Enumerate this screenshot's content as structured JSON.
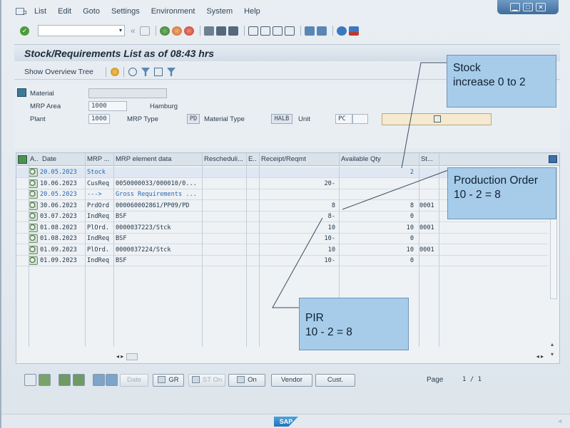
{
  "menu": [
    "List",
    "Edit",
    "Goto",
    "Settings",
    "Environment",
    "System",
    "Help"
  ],
  "window_buttons": [
    "minimize-icon",
    "maximize-icon",
    "close-icon"
  ],
  "window_button_glyphs": [
    "▁",
    "□",
    "✕"
  ],
  "toolbar": {
    "command_value": "",
    "dropdown_glyph": "▾",
    "back_glyph": "«"
  },
  "title": "Stock/Requirements List as of 08:43 hrs",
  "subtoolbar": {
    "show_overview_tree": "Show Overview Tree"
  },
  "header": {
    "material_label": "Material",
    "material_value": "",
    "material_desc": "",
    "mrp_area_label": "MRP Area",
    "mrp_area_value": "1000",
    "mrp_area_name": "Hamburg",
    "plant_label": "Plant",
    "plant_value": "1000",
    "mrp_type_label": "MRP Type",
    "mrp_type_value": "PD",
    "material_type_label": "Material Type",
    "material_type_value": "HALB",
    "unit_label": "Unit",
    "unit_value": "PC"
  },
  "grid": {
    "columns": [
      "A..",
      "Date",
      "MRP ...",
      "MRP element data",
      "Rescheduli...",
      "E..",
      "Receipt/Reqmt",
      "Available Qty",
      "St..."
    ],
    "rows": [
      {
        "date": "20.05.2023",
        "mrp": "Stock",
        "data": "",
        "qty": "",
        "avail": "2",
        "st": "",
        "blue": true,
        "selected": true
      },
      {
        "date": "10.06.2023",
        "mrp": "CusReq",
        "data": "0050000033/000010/0...",
        "qty": "20-",
        "avail": "",
        "st": "",
        "blue": false,
        "selected": false
      },
      {
        "date": "20.05.2023",
        "mrp": "--->",
        "data": "Gross Requirements ...",
        "qty": "",
        "avail": "",
        "st": "",
        "blue": true,
        "selected": false
      },
      {
        "date": "30.06.2023",
        "mrp": "PrdOrd",
        "data": "000060002861/PP09/PD",
        "qty": "8",
        "avail": "8",
        "st": "0001",
        "blue": false,
        "selected": false
      },
      {
        "date": "03.07.2023",
        "mrp": "IndReq",
        "data": "BSF",
        "qty": "8-",
        "avail": "0",
        "st": "",
        "blue": false,
        "selected": false
      },
      {
        "date": "01.08.2023",
        "mrp": "PlOrd.",
        "data": "0000037223/Stck",
        "qty": "10",
        "avail": "10",
        "st": "0001",
        "blue": false,
        "selected": false
      },
      {
        "date": "01.08.2023",
        "mrp": "IndReq",
        "data": "BSF",
        "qty": "10-",
        "avail": "0",
        "st": "",
        "blue": false,
        "selected": false
      },
      {
        "date": "01.09.2023",
        "mrp": "PlOrd.",
        "data": "0000037224/Stck",
        "qty": "10",
        "avail": "10",
        "st": "0001",
        "blue": false,
        "selected": false
      },
      {
        "date": "01.09.2023",
        "mrp": "IndReq",
        "data": "BSF",
        "qty": "10-",
        "avail": "0",
        "st": "",
        "blue": false,
        "selected": false
      }
    ],
    "pager_left": "◂ ▸",
    "pager_right": "◂ ▸"
  },
  "bottom": {
    "date_btn": "Date",
    "gr_btn": "GR",
    "st_on_btn": "ST On",
    "on_btn": "On",
    "vendor_btn": "Vendor",
    "cust_btn": "Cust.",
    "page_label": "Page",
    "page_value": "1  /  1"
  },
  "footer": {
    "logo": "SAP",
    "arrow": "◃"
  },
  "annotations": {
    "stock": "Stock\nincrease 0 to 2",
    "production": "Production Order\n10 - 2 = 8",
    "pir": "PIR\n 10 - 2 = 8"
  },
  "colors": {
    "accent": "#2d65b0",
    "callout": "#a6ccea",
    "title_bar": "#3f6d9c"
  }
}
